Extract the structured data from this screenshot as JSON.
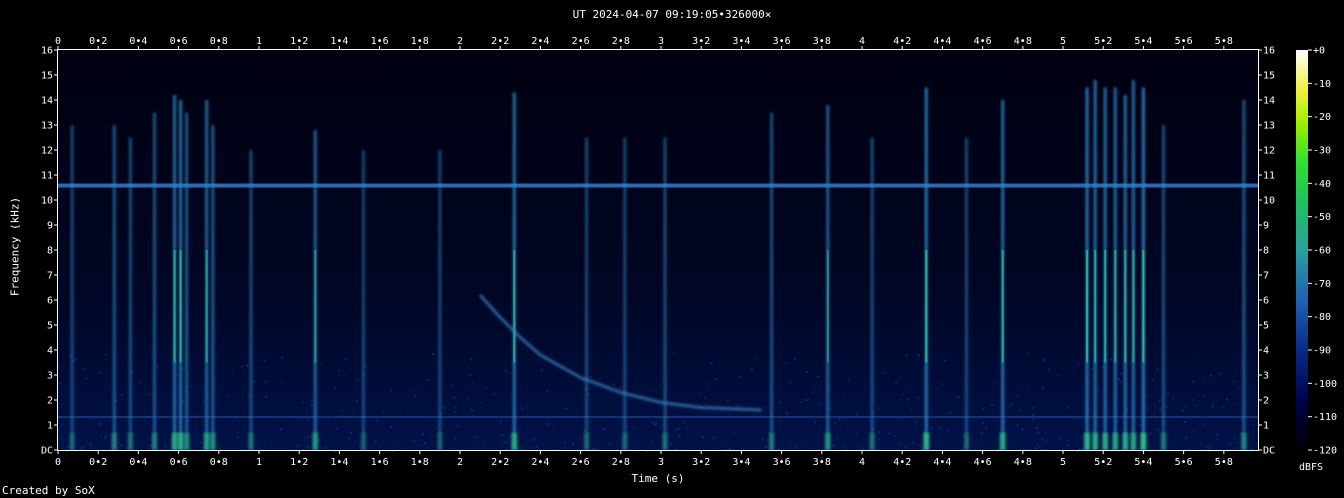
{
  "chart_data": {
    "type": "heatmap",
    "title": "UT 2024-04-07 09:19:05•326000×",
    "xlabel": "Time (s)",
    "ylabel": "Frequency (kHz)",
    "credit": "Created by SoX",
    "x_ticks": [
      "0",
      "0•2",
      "0•4",
      "0•6",
      "0•8",
      "1",
      "1•2",
      "1•4",
      "1•6",
      "1•8",
      "2",
      "2•2",
      "2•4",
      "2•6",
      "2•8",
      "3",
      "3•2",
      "3•4",
      "3•6",
      "3•8",
      "4",
      "4•2",
      "4•4",
      "4•6",
      "4•8",
      "5",
      "5•2",
      "5•4",
      "5•6",
      "5•8"
    ],
    "xlim": [
      0,
      5.97
    ],
    "y_ticks": [
      "DC",
      "1",
      "2",
      "3",
      "4",
      "5",
      "6",
      "7",
      "8",
      "9",
      "10",
      "11",
      "12",
      "13",
      "14",
      "15",
      "16"
    ],
    "ylim": [
      0,
      16
    ],
    "colorbar": {
      "label": "dBFS",
      "ticks": [
        "+0",
        "-10",
        "-20",
        "-30",
        "-40",
        "-50",
        "-60",
        "-70",
        "-80",
        "-90",
        "-100",
        "-110",
        "-120"
      ],
      "range": [
        -120,
        0
      ]
    },
    "features": {
      "tone_khz": 10.6,
      "tone_khz_2": 1.3,
      "whistler": [
        [
          2.1,
          6.2
        ],
        [
          2.2,
          5.3
        ],
        [
          2.3,
          4.5
        ],
        [
          2.4,
          3.8
        ],
        [
          2.6,
          2.9
        ],
        [
          2.8,
          2.3
        ],
        [
          3.0,
          1.9
        ],
        [
          3.2,
          1.7
        ],
        [
          3.5,
          1.6
        ]
      ],
      "sferics": [
        {
          "t": 0.07,
          "top": 13.0,
          "s": 0.35
        },
        {
          "t": 0.28,
          "top": 13.0,
          "s": 0.5
        },
        {
          "t": 0.36,
          "top": 12.5,
          "s": 0.4
        },
        {
          "t": 0.48,
          "top": 13.5,
          "s": 0.5
        },
        {
          "t": 0.58,
          "top": 14.2,
          "s": 0.85
        },
        {
          "t": 0.61,
          "top": 14.0,
          "s": 0.9
        },
        {
          "t": 0.64,
          "top": 13.5,
          "s": 0.6
        },
        {
          "t": 0.74,
          "top": 14.0,
          "s": 0.75
        },
        {
          "t": 0.77,
          "top": 13.0,
          "s": 0.6
        },
        {
          "t": 0.96,
          "top": 12.0,
          "s": 0.4
        },
        {
          "t": 1.28,
          "top": 12.8,
          "s": 0.7
        },
        {
          "t": 1.52,
          "top": 12.0,
          "s": 0.3
        },
        {
          "t": 1.9,
          "top": 12.0,
          "s": 0.3
        },
        {
          "t": 2.27,
          "top": 14.3,
          "s": 0.85
        },
        {
          "t": 2.63,
          "top": 12.5,
          "s": 0.35
        },
        {
          "t": 2.82,
          "top": 12.5,
          "s": 0.35
        },
        {
          "t": 3.02,
          "top": 12.5,
          "s": 0.4
        },
        {
          "t": 3.55,
          "top": 13.5,
          "s": 0.45
        },
        {
          "t": 3.83,
          "top": 13.8,
          "s": 0.65
        },
        {
          "t": 4.05,
          "top": 12.5,
          "s": 0.4
        },
        {
          "t": 4.32,
          "top": 14.5,
          "s": 0.95
        },
        {
          "t": 4.52,
          "top": 12.5,
          "s": 0.35
        },
        {
          "t": 4.7,
          "top": 14.0,
          "s": 0.85
        },
        {
          "t": 5.12,
          "top": 14.5,
          "s": 0.95
        },
        {
          "t": 5.16,
          "top": 14.8,
          "s": 0.85
        },
        {
          "t": 5.21,
          "top": 14.5,
          "s": 0.85
        },
        {
          "t": 5.26,
          "top": 14.5,
          "s": 0.8
        },
        {
          "t": 5.31,
          "top": 14.2,
          "s": 0.85
        },
        {
          "t": 5.35,
          "top": 14.8,
          "s": 0.8
        },
        {
          "t": 5.4,
          "top": 14.5,
          "s": 1.0
        },
        {
          "t": 5.5,
          "top": 13.0,
          "s": 0.45
        },
        {
          "t": 5.9,
          "top": 14.0,
          "s": 0.55
        }
      ]
    }
  }
}
